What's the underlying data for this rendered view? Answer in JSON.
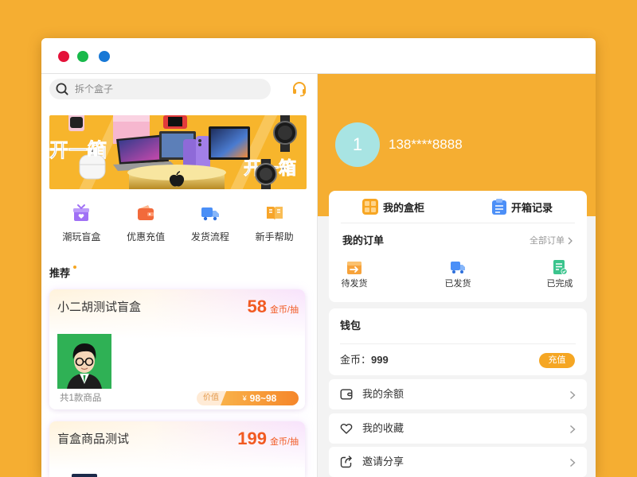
{
  "colors": {
    "background": "#F5AE32",
    "accent": "#F5AE32",
    "price": "#F15A22",
    "window_control_red": "#E4123A",
    "window_control_green": "#18B94A",
    "window_control_blue": "#1778D6",
    "avatar_bg": "#A8E4E3",
    "recharge_button": "#F5A623"
  },
  "home": {
    "search": {
      "placeholder": "拆个盒子",
      "icon": "search-icon"
    },
    "support_icon": "headset-icon",
    "banner": {
      "slogan": "开一箱"
    },
    "quick_links": [
      {
        "label": "潮玩盲盒",
        "icon": "gift-box-icon"
      },
      {
        "label": "优惠充值",
        "icon": "wallet-icon"
      },
      {
        "label": "发货流程",
        "icon": "truck-icon"
      },
      {
        "label": "新手帮助",
        "icon": "book-icon"
      }
    ],
    "section_title": "推荐",
    "products": [
      {
        "name": "小二胡测试盲盒",
        "price": "58",
        "price_unit": "金币/抽",
        "item_count": "共1款商品",
        "value_label": "价值",
        "value_currency": "¥",
        "value_range": "98~98"
      },
      {
        "name": "盲盒商品测试",
        "price": "199",
        "price_unit": "金币/抽"
      }
    ]
  },
  "profile": {
    "avatar_text": "1",
    "phone": "138****8888",
    "shortcuts": [
      {
        "label": "我的盒柜",
        "icon": "grid-icon"
      },
      {
        "label": "开箱记录",
        "icon": "clipboard-icon"
      }
    ],
    "orders": {
      "title": "我的订单",
      "all_link": "全部订单",
      "statuses": [
        {
          "label": "待发货",
          "icon": "package-arrow-icon"
        },
        {
          "label": "已发货",
          "icon": "truck-icon"
        },
        {
          "label": "已完成",
          "icon": "checklist-icon"
        }
      ]
    },
    "wallet": {
      "title": "钱包",
      "coins_label": "金币：",
      "coins_value": "999",
      "recharge_button": "充值"
    },
    "menu": [
      {
        "label": "我的余额",
        "icon": "wallet-outline-icon"
      },
      {
        "label": "我的收藏",
        "icon": "heart-outline-icon"
      },
      {
        "label": "邀请分享",
        "icon": "share-icon"
      }
    ]
  }
}
